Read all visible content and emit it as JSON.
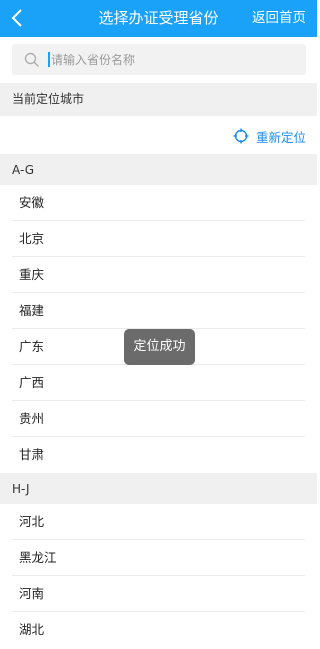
{
  "header": {
    "back_icon": "chevron-left-icon",
    "title": "选择办证受理省份",
    "home_label": "返回首页",
    "bar_color": "#1aa2f8"
  },
  "search": {
    "placeholder": "请输入省份名称",
    "icon": "search-icon"
  },
  "location": {
    "section_title": "当前定位城市",
    "relocate_label": "重新定位",
    "relocate_icon": "crosshair-icon",
    "accent_color": "#1a8cf0"
  },
  "groups": [
    {
      "header": "A-G",
      "items": [
        "安徽",
        "北京",
        "重庆",
        "福建",
        "广东",
        "广西",
        "贵州",
        "甘肃"
      ]
    },
    {
      "header": "H-J",
      "items": [
        "河北",
        "黑龙江",
        "河南",
        "湖北"
      ]
    }
  ],
  "toast": {
    "text": "定位成功"
  }
}
